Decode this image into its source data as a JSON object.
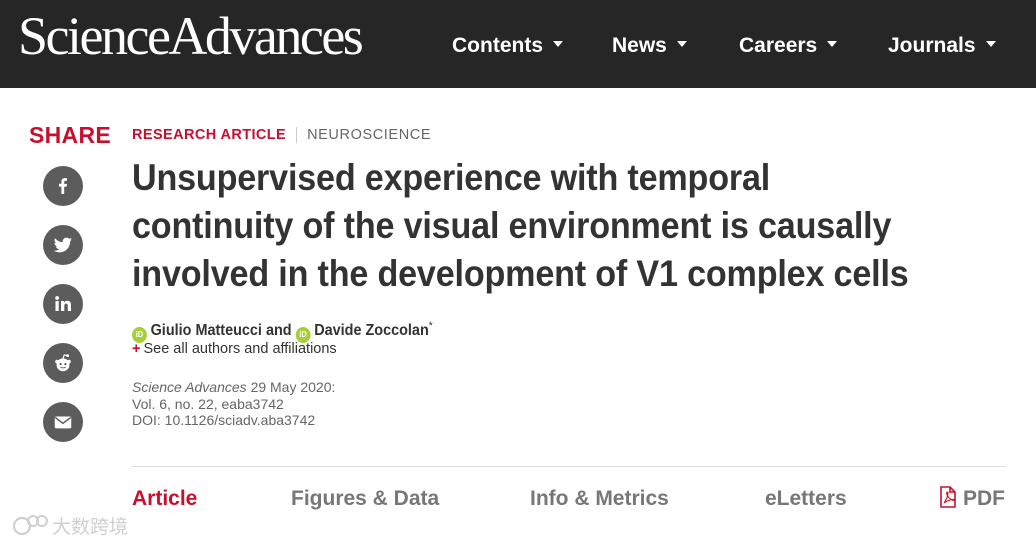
{
  "header": {
    "brand": "ScienceAdvances",
    "nav": [
      {
        "label": "Contents"
      },
      {
        "label": "News"
      },
      {
        "label": "Careers"
      },
      {
        "label": "Journals"
      }
    ]
  },
  "share": {
    "label": "SHARE",
    "buttons": [
      "facebook-icon",
      "twitter-icon",
      "linkedin-icon",
      "reddit-icon",
      "email-icon"
    ]
  },
  "article": {
    "type": "RESEARCH ARTICLE",
    "subject": "NEUROSCIENCE",
    "title": "Unsupervised experience with temporal continuity of the visual environment is causally involved in the development of V1 complex cells",
    "authors": [
      {
        "name": "Giulio Matteucci"
      },
      {
        "name": "Davide Zoccolan"
      }
    ],
    "authors_join": "and",
    "corresponding_mark": "*",
    "see_all": "See all authors and affiliations",
    "journal": "Science Advances",
    "date": "29 May 2020:",
    "volume": "Vol. 6, no. 22, eaba3742",
    "doi": "DOI: 10.1126/sciadv.aba3742"
  },
  "tabs": [
    {
      "label": "Article",
      "active": true
    },
    {
      "label": "Figures & Data"
    },
    {
      "label": "Info & Metrics"
    },
    {
      "label": "eLetters"
    },
    {
      "label": "PDF"
    }
  ],
  "watermark": {
    "text": "大数跨境"
  },
  "colors": {
    "accent": "#c8102e",
    "header_bg": "#262626",
    "share_icon_bg": "#5c5c5c",
    "orcid": "#a6ce39"
  }
}
